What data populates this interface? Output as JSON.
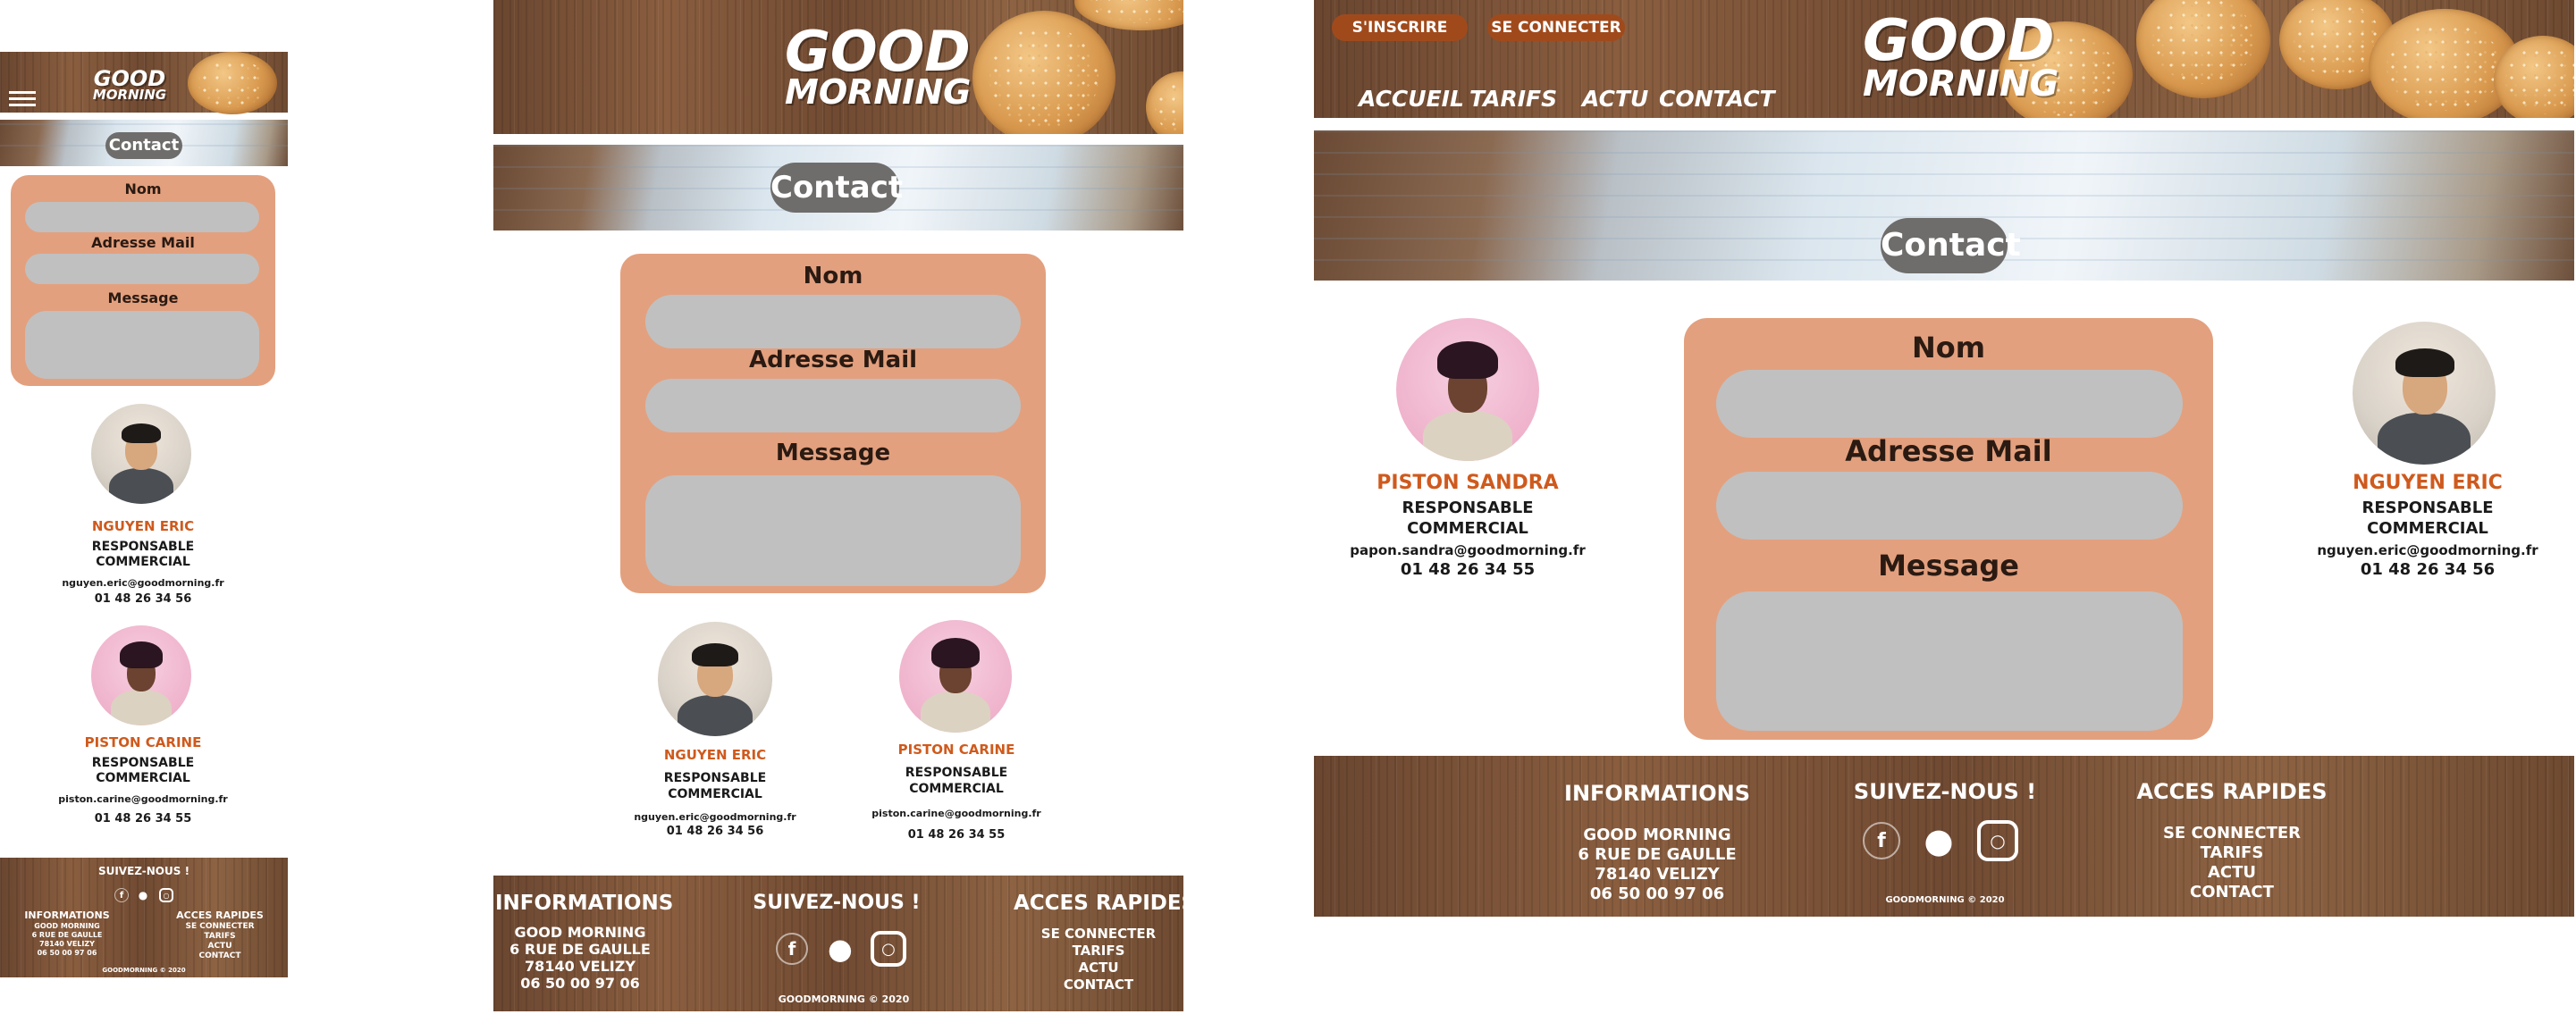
{
  "brand": {
    "logo_line1": "GOOD",
    "logo_line2": "MORNING"
  },
  "nav": {
    "signup": "S'INSCRIRE",
    "login": "SE CONNECTER",
    "links": [
      "ACCUEIL",
      "TARIFS",
      "ACTU",
      "CONTACT"
    ]
  },
  "page_title": "Contact",
  "form": {
    "name_label": "Nom",
    "email_label": "Adresse Mail",
    "message_label": "Message"
  },
  "contacts": {
    "eric": {
      "name": "NGUYEN  ERIC",
      "role": "RESPONSABLE\nCOMMERCIAL",
      "email": "nguyen.eric@goodmorning.fr",
      "phone": "01 48 26 34 56"
    },
    "carine": {
      "name": "PISTON CARINE",
      "role": "RESPONSABLE\nCOMMERCIAL",
      "email": "piston.carine@goodmorning.fr",
      "phone": "01 48 26 34 55"
    },
    "sandra": {
      "name": "PISTON SANDRA",
      "role": "RESPONSABLE\nCOMMERCIAL",
      "email": "papon.sandra@goodmorning.fr",
      "phone": "01 48 26 34 55"
    }
  },
  "footer": {
    "info_title": "INFORMATIONS",
    "info_lines": [
      "GOOD MORNING",
      "6 RUE DE GAULLE",
      "78140 VELIZY",
      "06 50 00 97 06"
    ],
    "follow_title": "SUIVEZ-NOUS !",
    "quick_title": "ACCES RAPIDES",
    "quick_links": [
      "SE CONNECTER",
      "TARIFS",
      "ACTU",
      "CONTACT"
    ],
    "copyright": "GOODMORNING © 2020",
    "social_icons": [
      "facebook-icon",
      "snapchat-icon",
      "instagram-icon"
    ]
  },
  "colors": {
    "accent": "#cf5a1d",
    "form_bg": "#e3a07e",
    "field": "#c0c0c0",
    "title_pill": "#6e6d6b",
    "button": "#a04a1c"
  }
}
